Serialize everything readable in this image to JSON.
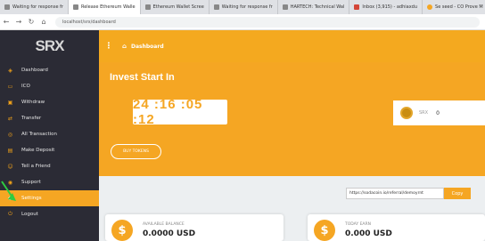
{
  "browser": {
    "tabs": [
      "Waiting for response fr",
      "Release Ethereum Walle",
      "Ethereum Wallet Scree",
      "Waiting for response fr",
      "HARTECH: Technical Wal",
      "Inbox (3,915) - adhiaxdu",
      "Se seed - CO  Prove M"
    ],
    "url": "localhost/srx/dashboard"
  },
  "sidebar": {
    "logo": "SRX",
    "items": [
      {
        "label": "Dashboard",
        "icon": "dashboard-icon",
        "glyph": "◈"
      },
      {
        "label": "ICO",
        "icon": "ico-icon",
        "glyph": "▭"
      },
      {
        "label": "Withdraw",
        "icon": "withdraw-icon",
        "glyph": "▣"
      },
      {
        "label": "Transfer",
        "icon": "transfer-icon",
        "glyph": "⇄"
      },
      {
        "label": "All Transaction",
        "icon": "transactions-icon",
        "glyph": "◎"
      },
      {
        "label": "Make Deposit",
        "icon": "deposit-icon",
        "glyph": "▤"
      },
      {
        "label": "Tell a Friend",
        "icon": "friend-icon",
        "glyph": "☺"
      },
      {
        "label": "Support",
        "icon": "support-icon",
        "glyph": "◉"
      },
      {
        "label": "Settings",
        "icon": "settings-icon",
        "glyph": "⚙"
      },
      {
        "label": "Logout",
        "icon": "logout-icon",
        "glyph": "⏻"
      }
    ],
    "active_index": 8
  },
  "topbar": {
    "breadcrumb": "Dashboard"
  },
  "invest": {
    "title": "Invest Start In",
    "countdown": "24 :16 :05 :12",
    "buy_button": "BUY TOKENS"
  },
  "srx_balance": {
    "label": "SRX",
    "value": "0"
  },
  "referral": {
    "link": "https://sodacoin.io/referral/demoyrnt",
    "copy_label": "Copy"
  },
  "cards": [
    {
      "label": "AVAILABLE BALANCE",
      "value": "0.0000 USD"
    },
    {
      "label": "TODAY EARN",
      "value": "0.000 USD"
    }
  ],
  "colors": {
    "accent": "#f5a623",
    "sidebar": "#2b2b35"
  }
}
